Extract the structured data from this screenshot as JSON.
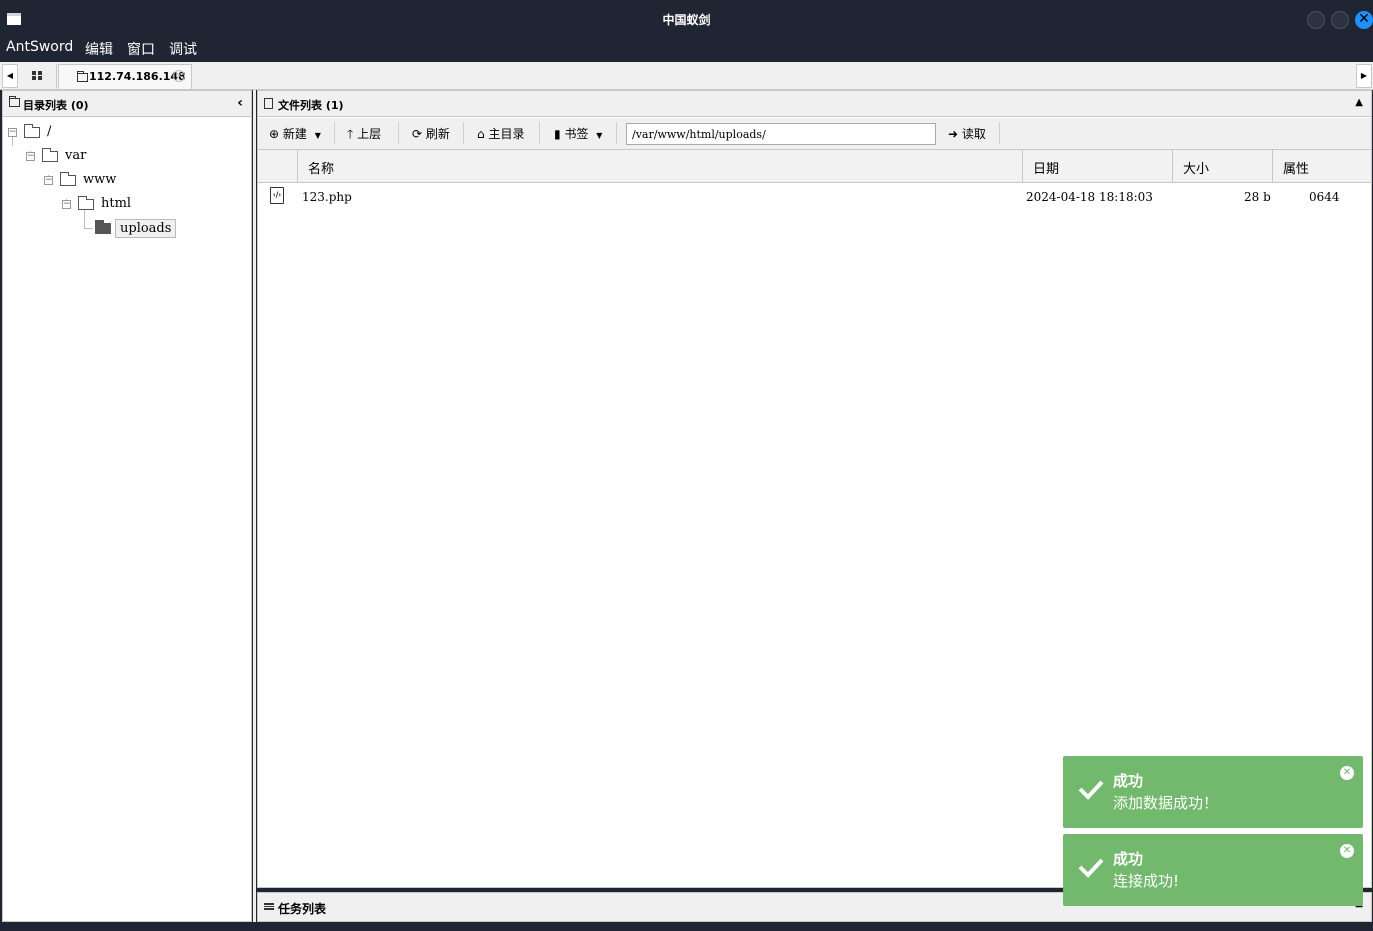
{
  "window": {
    "title": "中国蚁剑"
  },
  "menu": [
    "AntSword",
    "编辑",
    "窗口",
    "调试"
  ],
  "tabs": {
    "active_label": "112.74.186.148",
    "close_glyph": "×"
  },
  "left_panel": {
    "title": "目录列表 (0)",
    "tree": [
      {
        "label": "/",
        "level": 0
      },
      {
        "label": "var",
        "level": 1
      },
      {
        "label": "www",
        "level": 2
      },
      {
        "label": "html",
        "level": 3
      },
      {
        "label": "uploads",
        "level": 4,
        "selected": true
      }
    ]
  },
  "right_panel": {
    "title": "文件列表 (1)",
    "toolbar": {
      "new_label": "新建",
      "up_label": "上层",
      "refresh_label": "刷新",
      "home_label": "主目录",
      "bookmark_label": "书签",
      "path_value": "/var/www/html/uploads/",
      "read_label": "读取"
    },
    "columns": {
      "name": "名称",
      "date": "日期",
      "size": "大小",
      "attr": "属性"
    },
    "files": [
      {
        "name": "123.php",
        "date": "2024-04-18 18:18:03",
        "size": "28 b",
        "attr": "0644"
      }
    ]
  },
  "task_panel": {
    "title": "任务列表"
  },
  "toasts": [
    {
      "title": "成功",
      "message": "添加数据成功！"
    },
    {
      "title": "成功",
      "message": "连接成功!"
    }
  ],
  "colors": {
    "titlebar": "#1f2532",
    "toast_success": "#72b86d",
    "close_button": "#1e90ff"
  }
}
